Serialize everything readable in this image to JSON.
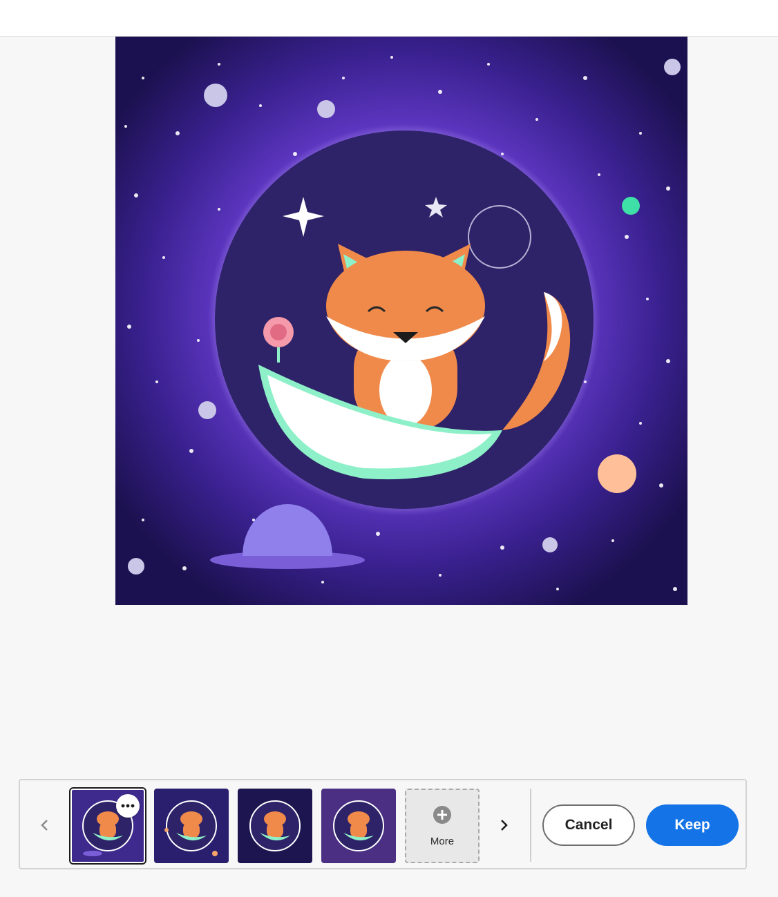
{
  "toolbar": {
    "cancel_label": "Cancel",
    "keep_label": "Keep"
  },
  "variations": {
    "more_label": "More",
    "selected_index": 0,
    "items": [
      {
        "name": "variation-1",
        "bg": "#3d2a8c"
      },
      {
        "name": "variation-2",
        "bg": "#2a1f6e"
      },
      {
        "name": "variation-3",
        "bg": "#1d1550"
      },
      {
        "name": "variation-4",
        "bg": "#4a2f82"
      }
    ]
  },
  "colors": {
    "accent": "#1473e6",
    "space": "#2b1a6b",
    "nebula": "#6b3fd4",
    "fox": "#f08a4b",
    "mint": "#8ef0c8"
  },
  "icons": {
    "prev": "chevron-left-icon",
    "next": "chevron-right-icon",
    "more": "more-horizontal-icon",
    "add": "plus-circle-icon"
  }
}
